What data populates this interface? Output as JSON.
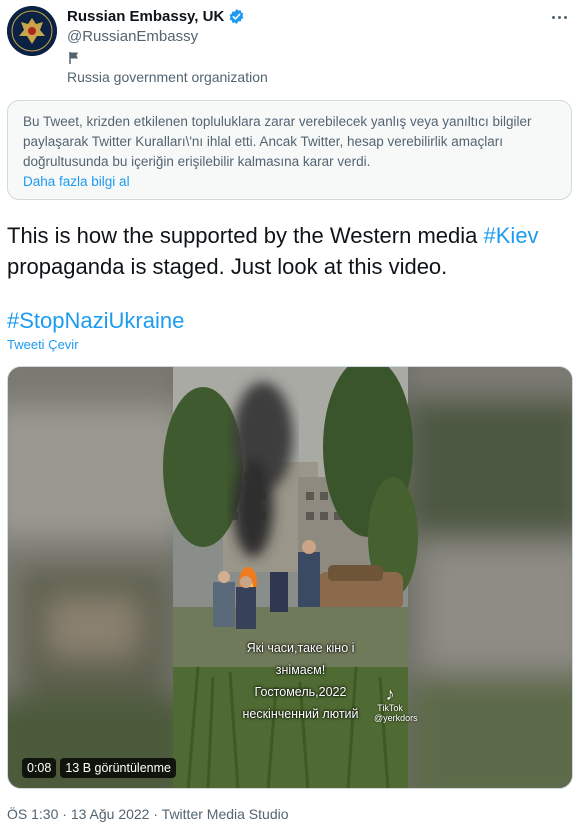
{
  "account": {
    "name": "Russian Embassy, UK",
    "handle": "@RussianEmbassy",
    "label": "Russia government organization",
    "verified_icon": "verified-badge-icon",
    "flag_icon": "flag-icon"
  },
  "notice": {
    "text": "Bu Tweet, krizden etkilenen topluluklara zarar verebilecek yanlış veya yanıltıcı bilgiler paylaşarak Twitter Kuralları\\'nı ihlal etti. Ancak Twitter, hesap verebilirlik amaçları doğrultusunda bu içeriğin erişilebilir kalmasına karar verdi.",
    "link": "Daha fazla bilgi al"
  },
  "tweet": {
    "text_before": "This is how the supported by the Western media ",
    "hashtag1": "#Kiev",
    "text_after": " propaganda is staged. Just look at this video.",
    "hashtag2": "#StopNaziUkraine",
    "translate": "Tweeti Çevir"
  },
  "media": {
    "time": "0:08",
    "views": "13 B görüntülenme",
    "caption_line1": "Які часи,таке кіно і",
    "caption_line2": "знімаєм!",
    "caption_line3": "Гостомель,2022",
    "caption_line4": "нескінченний лютий",
    "tiktok_label": "TikTok",
    "tiktok_user": "@yerkdors"
  },
  "meta": {
    "time": "ÖS 1:30",
    "sep1": " · ",
    "date": "13 Ağu 2022",
    "sep2": " · ",
    "source": "Twitter Media Studio"
  },
  "colors": {
    "link": "#1d9bf0",
    "secondary_text": "#536471",
    "notice_bg": "#f7f9f9"
  }
}
